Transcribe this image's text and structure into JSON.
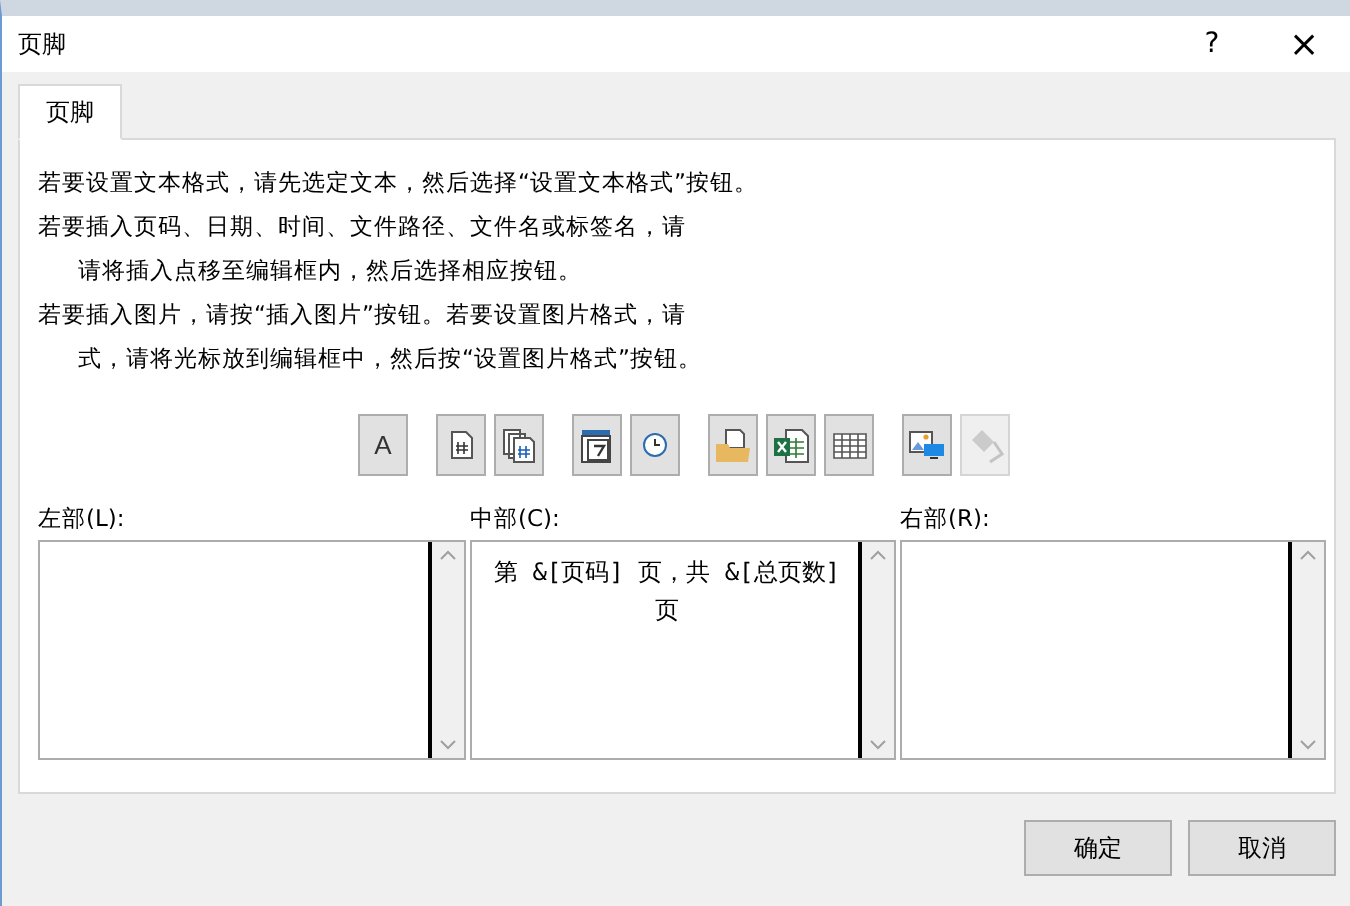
{
  "window": {
    "title": "页脚",
    "help": "?",
    "close": "×"
  },
  "tabs": [
    {
      "label": "页脚",
      "selected": true
    }
  ],
  "instructions": [
    "若要设置文本格式，请先选定文本，然后选择“设置文本格式”按钮。",
    "若要插入页码、日期、时间、文件路径、文件名或标签名，请",
    "请将插入点移至编辑框内，然后选择相应按钮。",
    "若要插入图片，请按“插入图片”按钮。若要设置图片格式，请",
    "式，请将光标放到编辑框中，然后按“设置图片格式”按钮。"
  ],
  "instruction_indent": [
    false,
    false,
    true,
    false,
    true
  ],
  "toolbar": [
    [
      {
        "kind": "font",
        "label": "A",
        "disabled": false
      }
    ],
    [
      {
        "kind": "page",
        "disabled": false
      },
      {
        "kind": "pages",
        "disabled": false
      }
    ],
    [
      {
        "kind": "date",
        "disabled": false
      },
      {
        "kind": "time",
        "disabled": false
      }
    ],
    [
      {
        "kind": "path",
        "disabled": false
      },
      {
        "kind": "file",
        "disabled": false
      },
      {
        "kind": "sheet",
        "disabled": false
      }
    ],
    [
      {
        "kind": "picture",
        "disabled": false
      },
      {
        "kind": "format-picture",
        "disabled": true
      }
    ]
  ],
  "sections": [
    {
      "label": "左部(L):"
    },
    {
      "label": "中部(C):",
      "value": "第 &[页码] 页，共 &[总页数] 页"
    },
    {
      "label": "右部(R):"
    }
  ],
  "buttons": [
    "确定",
    "取消"
  ]
}
